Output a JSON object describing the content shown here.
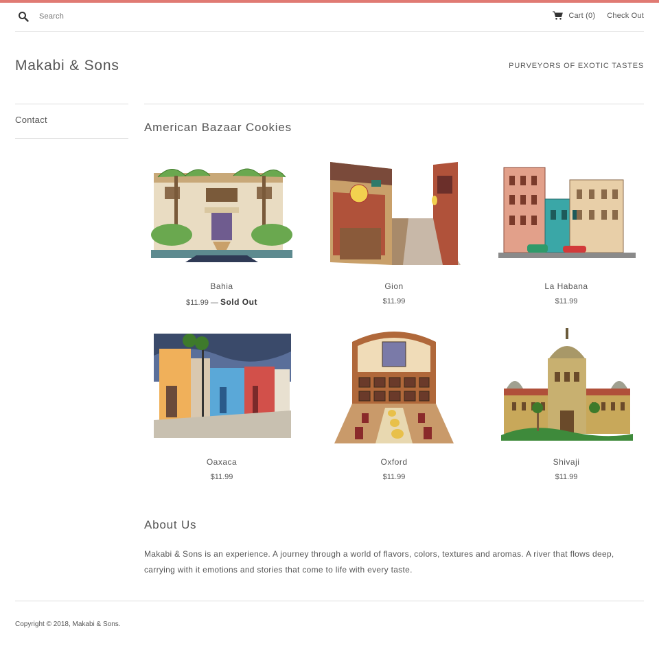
{
  "header": {
    "search_placeholder": "Search",
    "cart_label": "Cart (0)",
    "checkout_label": "Check Out",
    "accent_color": "#e07a73"
  },
  "brand": {
    "logo": "Makabi & Sons",
    "tagline": "PURVEYORS OF EXOTIC TASTES"
  },
  "sidebar": {
    "items": [
      {
        "label": "Contact"
      }
    ]
  },
  "collection": {
    "title": "American Bazaar Cookies",
    "products": [
      {
        "name": "Bahia",
        "price": "$11.99",
        "status": "Sold Out",
        "separator": "—"
      },
      {
        "name": "Gion",
        "price": "$11.99"
      },
      {
        "name": "La Habana",
        "price": "$11.99"
      },
      {
        "name": "Oaxaca",
        "price": "$11.99"
      },
      {
        "name": "Oxford",
        "price": "$11.99"
      },
      {
        "name": "Shivaji",
        "price": "$11.99"
      }
    ]
  },
  "about": {
    "title": "About Us",
    "text": "Makabi & Sons is an experience. A journey through a world of flavors, colors, textures and aromas. A river that flows deep, carrying with it emotions and stories that come to life with every taste."
  },
  "footer": {
    "copyright": "Copyright © 2018, Makabi & Sons."
  }
}
